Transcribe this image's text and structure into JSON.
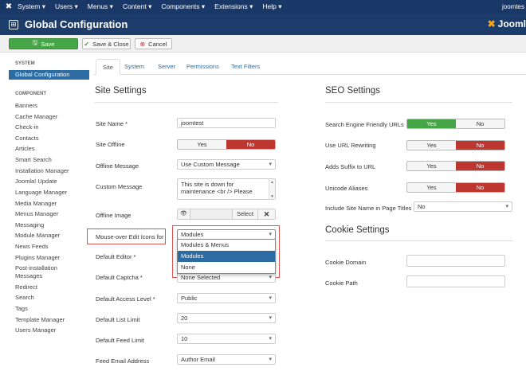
{
  "topnav": {
    "logo_icon": "joomla-icon",
    "menus": [
      "System ▾",
      "Users ▾",
      "Menus ▾",
      "Content ▾",
      "Components ▾",
      "Extensions ▾",
      "Help ▾"
    ],
    "user": "joomtes"
  },
  "header": {
    "title": "Global Configuration",
    "brand": "Jooml"
  },
  "toolbar": {
    "save_label": "Save",
    "save_close_label": "Save & Close",
    "cancel_label": "Cancel"
  },
  "sidebar": {
    "system_heading": "SYSTEM",
    "active_item": "Global Configuration",
    "component_heading": "COMPONENT",
    "items": [
      "Banners",
      "Cache Manager",
      "Check-in",
      "Contacts",
      "Articles",
      "Smart Search",
      "Installation Manager",
      "Joomla! Update",
      "Language Manager",
      "Media Manager",
      "Menus Manager",
      "Messaging",
      "Module Manager",
      "News Feeds",
      "Plugins Manager",
      "Post-installation",
      "Messages",
      "Redirect",
      "Search",
      "Tags",
      "Template Manager",
      "Users Manager"
    ]
  },
  "tabs": [
    "Site",
    "System",
    "Server",
    "Permissions",
    "Text Filters"
  ],
  "site_settings": {
    "heading": "Site Settings",
    "site_name_label": "Site Name *",
    "site_name_value": "joomtest",
    "site_offline_label": "Site Offline",
    "yes": "Yes",
    "no": "No",
    "offline_message_label": "Offline Message",
    "offline_message_value": "Use Custom Message",
    "custom_message_label": "Custom Message",
    "custom_message_line1": "This site is down for",
    "custom_message_line2": "maintenance <br /> Please",
    "offline_image_label": "Offline Image",
    "select_label": "Select",
    "mouseover_label": "Mouse-over Edit Icons for",
    "mouseover_value": "Modules",
    "dropdown_options": [
      "Modules & Menus",
      "Modules",
      "None"
    ],
    "default_editor_label": "Default Editor *",
    "default_captcha_label": "Default Captcha *",
    "default_captcha_value": "None Selected",
    "default_access_label": "Default Access Level *",
    "default_access_value": "Public",
    "default_list_label": "Default List Limit",
    "default_list_value": "20",
    "default_feed_label": "Default Feed Limit",
    "default_feed_value": "10",
    "feed_email_label": "Feed Email Address",
    "feed_email_value": "Author Email"
  },
  "seo_settings": {
    "heading": "SEO Settings",
    "sef_label": "Search Engine Friendly URLs",
    "rewrite_label": "Use URL Rewriting",
    "suffix_label": "Adds Suffix to URL",
    "unicode_label": "Unicode Aliases",
    "include_site_label": "Include Site Name in Page Titles",
    "include_site_value": "No"
  },
  "cookie_settings": {
    "heading": "Cookie Settings",
    "domain_label": "Cookie Domain",
    "path_label": "Cookie Path"
  }
}
